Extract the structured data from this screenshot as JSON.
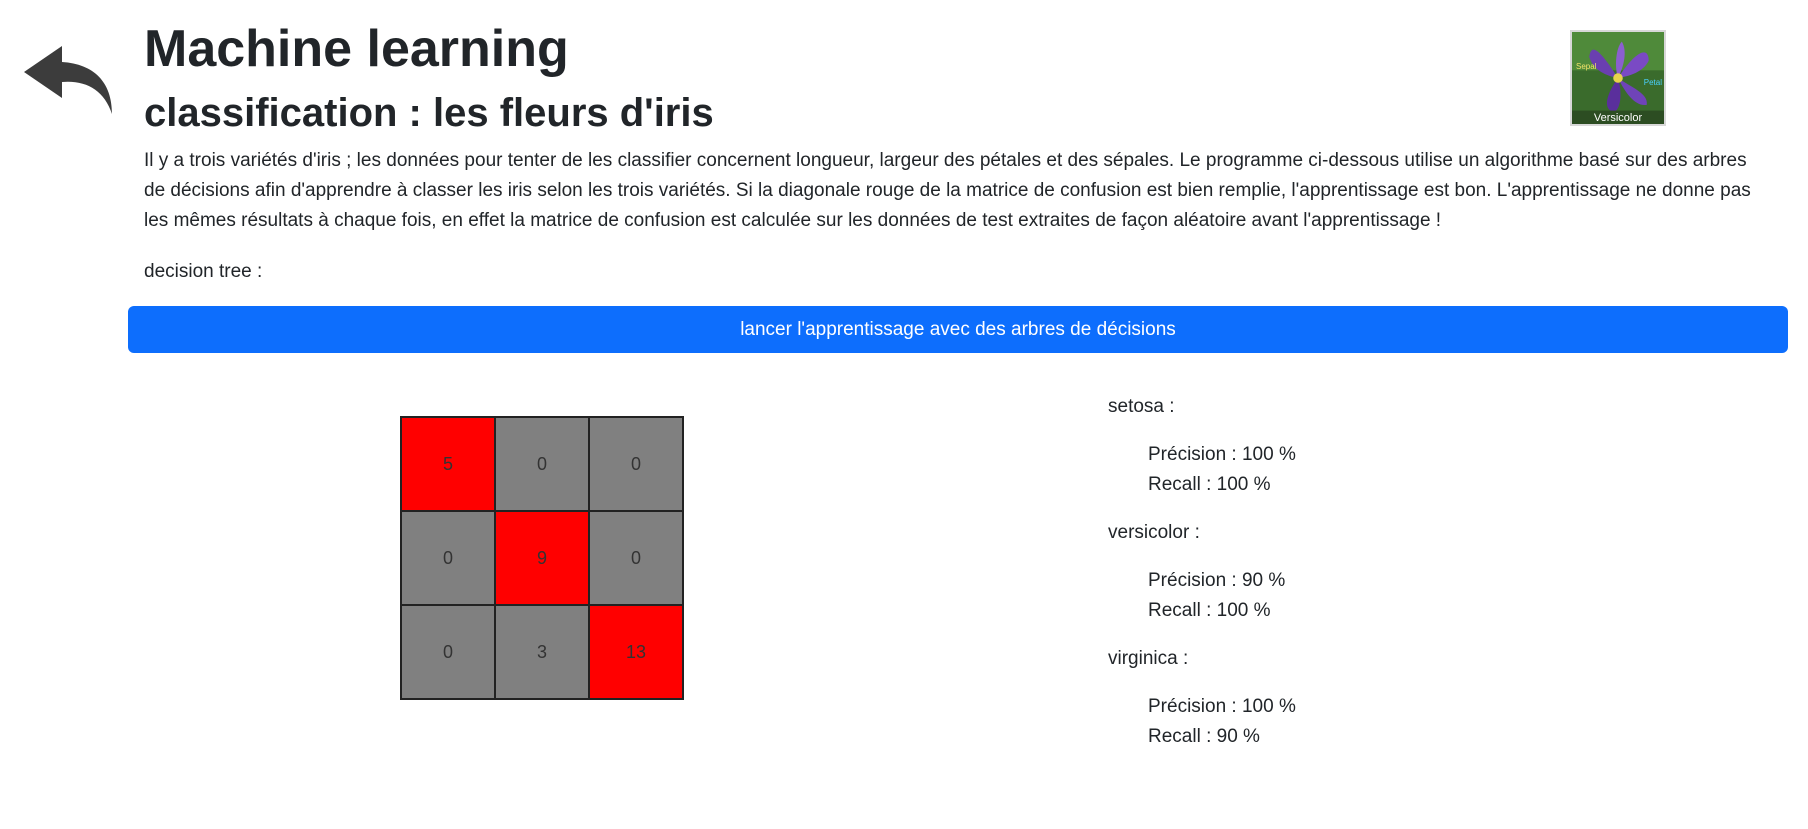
{
  "header": {
    "title": "Machine learning",
    "subtitle": "classification : les fleurs d'iris",
    "back_icon": "back-arrow-icon",
    "thumbnail": {
      "labels": {
        "left": "Sepal",
        "right": "Petal",
        "bottom": "Versicolor"
      }
    }
  },
  "intro": {
    "description": "Il y a trois variétés d'iris ; les données pour tenter de les classifier concernent longueur, largeur des pétales et des sépales. Le programme ci-dessous utilise un algorithme basé sur des arbres de décisions afin d'apprendre à classer les iris selon les trois variétés. Si la diagonale rouge de la matrice de confusion est bien remplie, l'apprentissage est bon. L'apprentissage ne donne pas les mêmes résultats à chaque fois, en effet la matrice de confusion est calculée sur les données de test extraites de façon aléatoire avant l'apprentissage !",
    "decision_tree_label": "decision tree :"
  },
  "actions": {
    "train_button": "lancer l'apprentissage avec des arbres de décisions"
  },
  "colors": {
    "button": "#0d6efd",
    "diagonal": "#ff0000",
    "off_diagonal": "#808080"
  },
  "confusion_matrix": {
    "rows": [
      [
        "5",
        "0",
        "0"
      ],
      [
        "0",
        "9",
        "0"
      ],
      [
        "0",
        "3",
        "13"
      ]
    ]
  },
  "metrics": [
    {
      "name": "setosa :",
      "precision": "Précision : 100 %",
      "recall": "Recall : 100 %"
    },
    {
      "name": "versicolor :",
      "precision": "Précision : 90 %",
      "recall": "Recall : 100 %"
    },
    {
      "name": "virginica :",
      "precision": "Précision : 100 %",
      "recall": "Recall : 90 %"
    }
  ]
}
